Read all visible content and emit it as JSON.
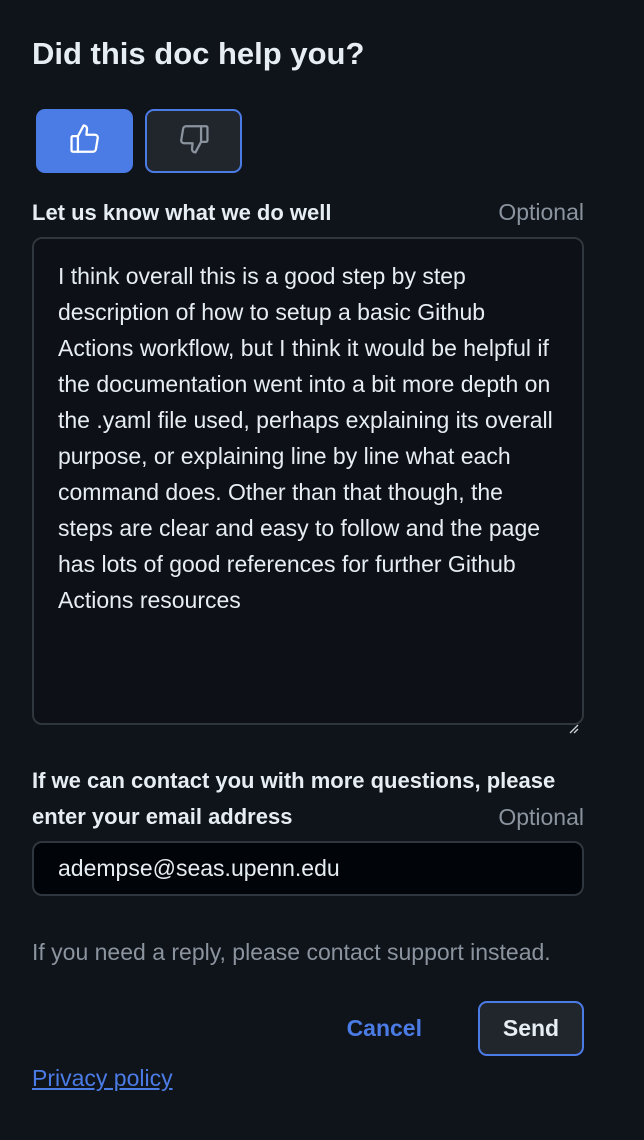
{
  "feedback": {
    "title": "Did this doc help you?",
    "vote_up_icon": "thumbs-up-icon",
    "vote_down_icon": "thumbs-down-icon",
    "comment_label": "Let us know what we do well",
    "comment_optional": "Optional",
    "comment_value": "I think overall this is a good step by step description of how to setup a basic Github Actions workflow, but I think it would be helpful if the documentation went into a bit more depth on the .yaml file used, perhaps explaining its overall purpose, or explaining line by line what each command does. Other than that though, the steps are clear and easy to follow and the page has lots of good references for further Github Actions resources",
    "contact_label": "If we can contact you with more questions, please enter your email address",
    "contact_optional": "Optional",
    "email_value": "adempse@seas.upenn.edu",
    "note": "If you need a reply, please contact support instead.",
    "cancel_label": "Cancel",
    "send_label": "Send",
    "privacy_label": "Privacy policy"
  },
  "colors": {
    "background": "#0f131a",
    "accent": "#4b7be5",
    "muted": "#8b949e",
    "text": "#e6edf3"
  }
}
